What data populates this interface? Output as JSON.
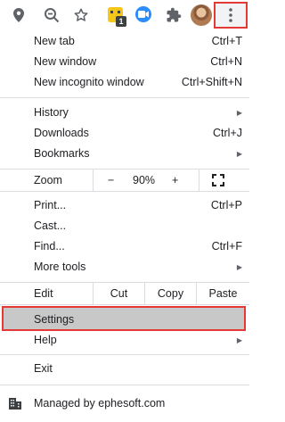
{
  "toolbar": {
    "icons": [
      "location-icon",
      "zoom-icon",
      "bookmark-star-icon",
      "extension-badge-icon",
      "zoom-app-icon",
      "extensions-puzzle-icon",
      "profile-avatar",
      "more-menu-icon"
    ],
    "extension_badge_count": "1"
  },
  "menu": {
    "new_tab": {
      "label": "New tab",
      "shortcut": "Ctrl+T"
    },
    "new_window": {
      "label": "New window",
      "shortcut": "Ctrl+N"
    },
    "new_incognito": {
      "label": "New incognito window",
      "shortcut": "Ctrl+Shift+N"
    },
    "history": {
      "label": "History"
    },
    "downloads": {
      "label": "Downloads",
      "shortcut": "Ctrl+J"
    },
    "bookmarks": {
      "label": "Bookmarks"
    },
    "zoom": {
      "label": "Zoom",
      "minus": "−",
      "level": "90%",
      "plus": "+"
    },
    "print": {
      "label": "Print...",
      "shortcut": "Ctrl+P"
    },
    "cast": {
      "label": "Cast..."
    },
    "find": {
      "label": "Find...",
      "shortcut": "Ctrl+F"
    },
    "more_tools": {
      "label": "More tools"
    },
    "edit": {
      "label": "Edit",
      "cut": "Cut",
      "copy": "Copy",
      "paste": "Paste"
    },
    "settings": {
      "label": "Settings"
    },
    "help": {
      "label": "Help"
    },
    "exit": {
      "label": "Exit"
    },
    "managed": {
      "label": "Managed by ephesoft.com"
    }
  },
  "colors": {
    "highlight_border": "#e53935",
    "settings_bg": "#c8c8c8",
    "separator": "#dadce0"
  }
}
